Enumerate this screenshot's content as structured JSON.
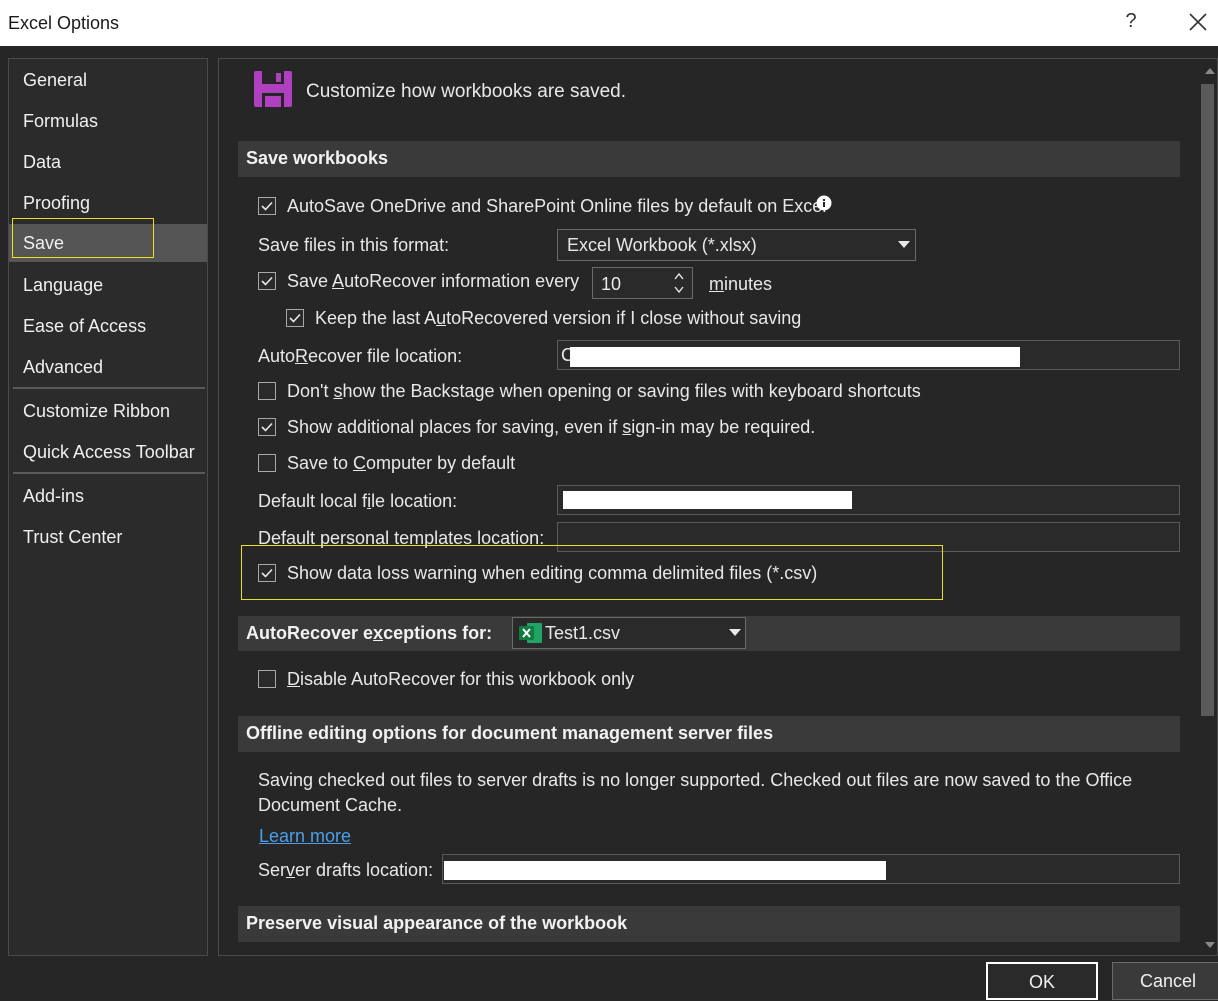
{
  "window": {
    "title": "Excel Options",
    "help_glyph": "?",
    "close_icon": "close-icon"
  },
  "nav": {
    "items": [
      {
        "label": "General"
      },
      {
        "label": "Formulas"
      },
      {
        "label": "Data"
      },
      {
        "label": "Proofing"
      },
      {
        "label": "Save",
        "selected": true
      },
      {
        "label": "Language"
      },
      {
        "label": "Ease of Access"
      },
      {
        "label": "Advanced"
      },
      {
        "label": "Customize Ribbon"
      },
      {
        "label": "Quick Access Toolbar"
      },
      {
        "label": "Add-ins"
      },
      {
        "label": "Trust Center"
      }
    ]
  },
  "header": {
    "icon": "save-disk-icon",
    "icon_color": "#b040c0",
    "text": "Customize how workbooks are saved."
  },
  "save_workbooks": {
    "heading": "Save workbooks",
    "autosave_label": "AutoSave OneDrive and SharePoint Online files by default on Excel",
    "autosave_checked": true,
    "format_label": "Save files in this format:",
    "format_value": "Excel Workbook (*.xlsx)",
    "autorecover_label_pre": "Save ",
    "autorecover_label_u": "A",
    "autorecover_label_post": "utoRecover information every",
    "autorecover_checked": true,
    "autorecover_minutes": "10",
    "minutes_u": "m",
    "minutes_rest": "inutes",
    "keep_last_pre": "Keep the last A",
    "keep_last_u": "u",
    "keep_last_post": "toRecovered version if I close without saving",
    "keep_last_checked": true,
    "ar_location_pre": "Auto",
    "ar_location_u": "R",
    "ar_location_post": "ecover file location:",
    "ar_location_value": "C",
    "backstage_pre": "Don't ",
    "backstage_u": "s",
    "backstage_post": "how the Backstage when opening or saving files with keyboard shortcuts",
    "backstage_checked": false,
    "additional_pre": "Show additional places for saving, even if ",
    "additional_u": "s",
    "additional_post": "ign-in may be required.",
    "additional_checked": true,
    "computer_pre": "Save to ",
    "computer_u": "C",
    "computer_post": "omputer by default",
    "computer_checked": false,
    "local_pre": "Default local f",
    "local_u": "i",
    "local_post": "le location:",
    "templates_pre": "Default personal ",
    "templates_u": "t",
    "templates_post": "emplates location:",
    "csv_label": "Show data loss warning when editing comma delimited files (*.csv)",
    "csv_checked": true
  },
  "exceptions": {
    "heading_pre": "AutoRecover e",
    "heading_u": "x",
    "heading_post": "ceptions for:",
    "workbook": "Test1.csv",
    "workbook_icon": "excel-file-icon",
    "disable_u": "D",
    "disable_post": "isable AutoRecover for this workbook only",
    "disable_checked": false
  },
  "offline": {
    "heading": "Offline editing options for document management server files",
    "desc_line1": "Saving checked out files to server drafts is no longer supported. Checked out files are now saved to the Office",
    "desc_line2": "Document Cache.",
    "learn_more": "Learn more",
    "drafts_pre": "Ser",
    "drafts_u": "v",
    "drafts_post": "er drafts location:"
  },
  "preserve": {
    "heading": "Preserve visual appearance of the workbook"
  },
  "buttons": {
    "ok": "OK",
    "cancel": "Cancel"
  }
}
